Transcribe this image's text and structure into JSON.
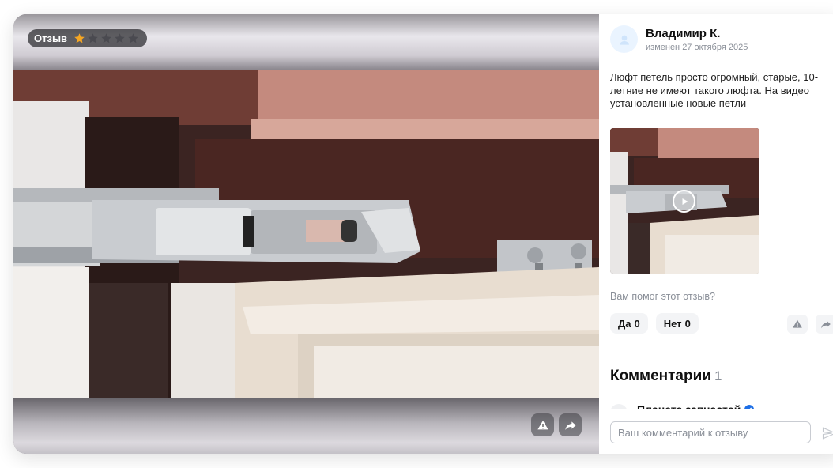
{
  "badge": {
    "label": "Отзыв",
    "rating": 1,
    "max_rating": 5
  },
  "author": {
    "name": "Владимир К.",
    "date": "изменен 27 октября 2025"
  },
  "review": {
    "text": "Люфт петель просто огромный, старые, 10-летние не имеют такого люфта. На видео установленные новые петли"
  },
  "helpful": {
    "question": "Вам помог этот отзыв?",
    "yes_label": "Да",
    "yes_count": "0",
    "no_label": "Нет",
    "no_count": "0"
  },
  "comments": {
    "title": "Комментарии",
    "count": "1",
    "first_author": "Планета запчастей"
  },
  "comment_input": {
    "placeholder": "Ваш комментарий к отзыву"
  },
  "icons": {
    "star_filled": "star-icon",
    "complaint": "warning-icon",
    "share": "share-icon",
    "play": "play-icon",
    "send": "send-icon",
    "verified": "verified-icon"
  },
  "colors": {
    "star_active": "#f5a623",
    "star_inactive": "#4a4a50",
    "verified": "#1e6fe6",
    "muted_text": "#8a8f98",
    "button_bg": "#f3f4f6"
  }
}
